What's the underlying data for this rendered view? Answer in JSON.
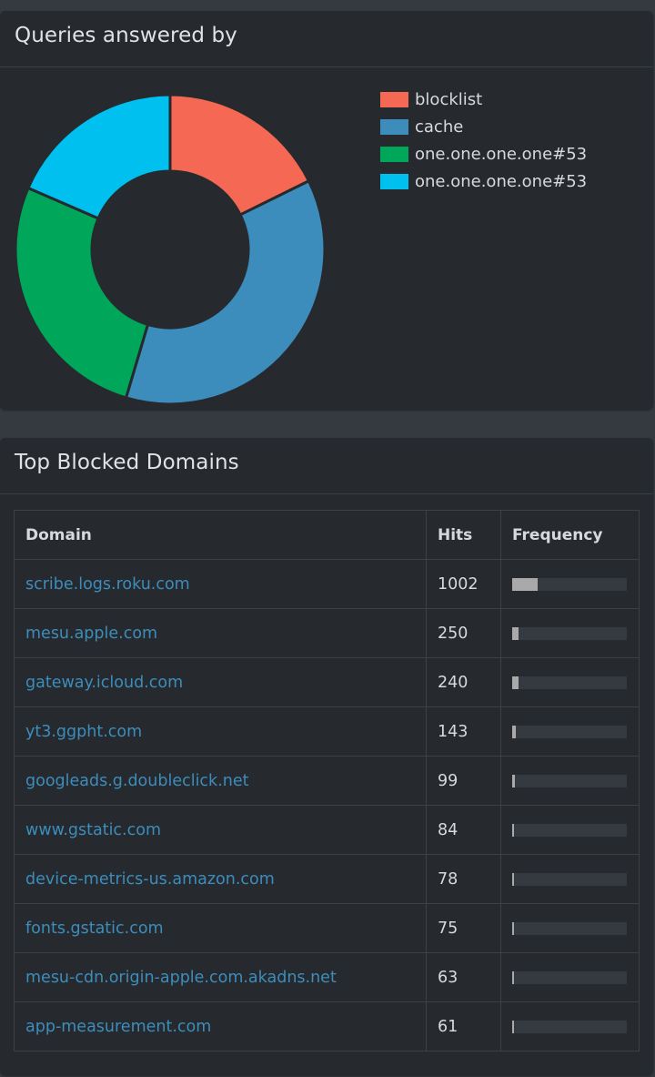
{
  "queries_panel": {
    "title": "Queries answered by",
    "legend": [
      {
        "label": "blocklist",
        "color": "#f56954"
      },
      {
        "label": "cache",
        "color": "#3c8dbc"
      },
      {
        "label": "one.one.one.one#53",
        "color": "#00a65a"
      },
      {
        "label": "one.one.one.one#53",
        "color": "#00c0ef"
      }
    ]
  },
  "chart_data": {
    "type": "pie",
    "labels": [
      "blocklist",
      "cache",
      "one.one.one.one#53",
      "one.one.one.one#53"
    ],
    "values": [
      17.7,
      36.9,
      26.9,
      18.5
    ],
    "colors": [
      "#f56954",
      "#3c8dbc",
      "#00a65a",
      "#00c0ef"
    ],
    "legend_position": "right"
  },
  "blocked_panel": {
    "title": "Top Blocked Domains",
    "columns": [
      "Domain",
      "Hits",
      "Frequency"
    ],
    "rows": [
      {
        "domain": "scribe.logs.roku.com",
        "hits": "1002",
        "frequency_pct": 22
      },
      {
        "domain": "mesu.apple.com",
        "hits": "250",
        "frequency_pct": 5.5
      },
      {
        "domain": "gateway.icloud.com",
        "hits": "240",
        "frequency_pct": 5.3
      },
      {
        "domain": "yt3.ggpht.com",
        "hits": "143",
        "frequency_pct": 3.1
      },
      {
        "domain": "googleads.g.doubleclick.net",
        "hits": "99",
        "frequency_pct": 2.2
      },
      {
        "domain": "www.gstatic.com",
        "hits": "84",
        "frequency_pct": 1.8
      },
      {
        "domain": "device-metrics-us.amazon.com",
        "hits": "78",
        "frequency_pct": 1.7
      },
      {
        "domain": "fonts.gstatic.com",
        "hits": "75",
        "frequency_pct": 1.6
      },
      {
        "domain": "mesu-cdn.origin-apple.com.akadns.net",
        "hits": "63",
        "frequency_pct": 1.4
      },
      {
        "domain": "app-measurement.com",
        "hits": "61",
        "frequency_pct": 1.3
      }
    ]
  }
}
